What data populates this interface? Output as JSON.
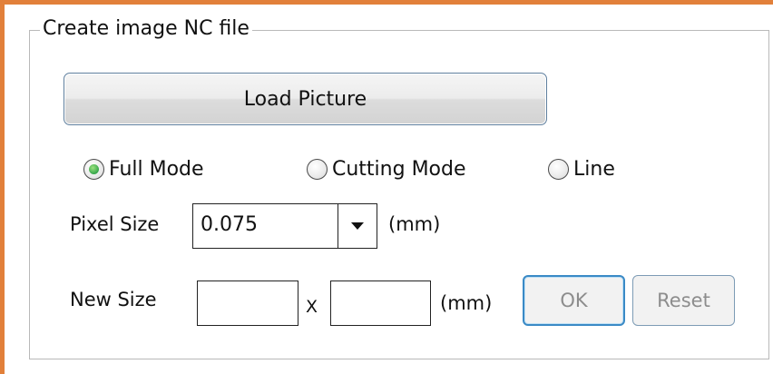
{
  "group": {
    "title": "Create image NC file"
  },
  "load_button": {
    "label": "Load Picture"
  },
  "modes": [
    {
      "label": "Full Mode",
      "checked": true
    },
    {
      "label": "Cutting Mode",
      "checked": false
    },
    {
      "label": "Line",
      "checked": false
    }
  ],
  "pixel_size": {
    "label": "Pixel Size",
    "value": "0.075",
    "unit": "(mm)",
    "dropdown_icon": "chevron-down-icon"
  },
  "new_size": {
    "label": "New Size",
    "width_value": "",
    "height_value": "",
    "separator": "X",
    "unit": "(mm)"
  },
  "buttons": {
    "ok_label": "OK",
    "reset_label": "Reset"
  },
  "colors": {
    "frame_accent": "#e2803a",
    "radio_checked": "#35a64a"
  }
}
